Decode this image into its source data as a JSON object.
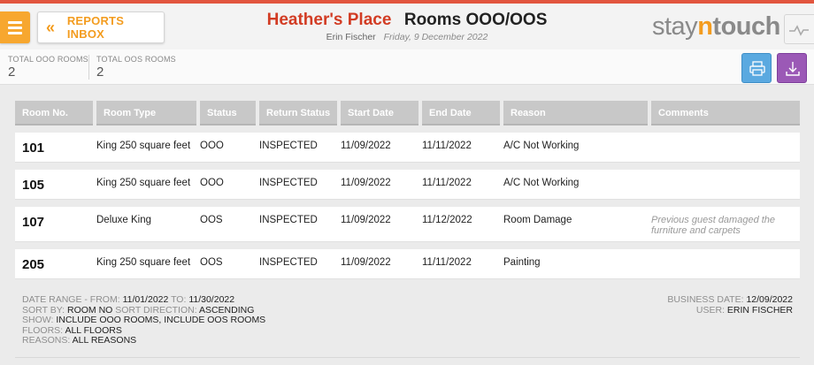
{
  "colors": {
    "accent_red": "#e2553e",
    "menu_orange": "#f7a72f",
    "back_orange": "#f39c1f",
    "print_blue": "#5aa9e0",
    "download_purple": "#9b59b6"
  },
  "header": {
    "back_label": "REPORTS INBOX",
    "back_icon": "double-chevron-left-icon",
    "hotel_name": "Heather's Place",
    "report_name": "Rooms OOO/OOS",
    "user_name": "Erin Fischer",
    "date_text": "Friday, 9 December 2022",
    "logo": {
      "part1": "stay",
      "part2": "n",
      "part3": "touch"
    }
  },
  "stats": [
    {
      "label": "TOTAL OOO ROOMS",
      "value": "2"
    },
    {
      "label": "TOTAL OOS ROOMS",
      "value": "2"
    }
  ],
  "table": {
    "columns": [
      "Room No.",
      "Room Type",
      "Status",
      "Return Status",
      "Start Date",
      "End Date",
      "Reason",
      "Comments"
    ],
    "rows": [
      {
        "room": "101",
        "type": "King 250 square feet",
        "status": "OOO",
        "return_status": "INSPECTED",
        "start": "11/09/2022",
        "end": "11/11/2022",
        "reason": "A/C Not Working",
        "comment": ""
      },
      {
        "room": "105",
        "type": "King 250 square feet",
        "status": "OOO",
        "return_status": "INSPECTED",
        "start": "11/09/2022",
        "end": "11/11/2022",
        "reason": "A/C Not Working",
        "comment": ""
      },
      {
        "room": "107",
        "type": "Deluxe King",
        "status": "OOS",
        "return_status": "INSPECTED",
        "start": "11/09/2022",
        "end": "11/12/2022",
        "reason": "Room Damage",
        "comment": "Previous guest damaged the furniture and carpets"
      },
      {
        "room": "205",
        "type": "King 250 square feet",
        "status": "OOS",
        "return_status": "INSPECTED",
        "start": "11/09/2022",
        "end": "11/11/2022",
        "reason": "Painting",
        "comment": ""
      }
    ]
  },
  "footer": {
    "date_range_label": "DATE RANGE - FROM:",
    "date_from": "11/01/2022",
    "to_label": "TO:",
    "date_to": "11/30/2022",
    "sort_by_label": "SORT BY:",
    "sort_by": "ROOM NO",
    "sort_dir_label": "SORT DIRECTION:",
    "sort_dir": "ASCENDING",
    "show_label": "SHOW:",
    "show_value": "INCLUDE OOO ROOMS, INCLUDE OOS ROOMS",
    "floors_label": "FLOORS:",
    "floors_value": "ALL FLOORS",
    "reasons_label": "REASONS:",
    "reasons_value": "ALL REASONS",
    "business_date_label": "BUSINESS DATE:",
    "business_date": "12/09/2022",
    "user_label": "USER:",
    "user_value": "ERIN FISCHER"
  }
}
